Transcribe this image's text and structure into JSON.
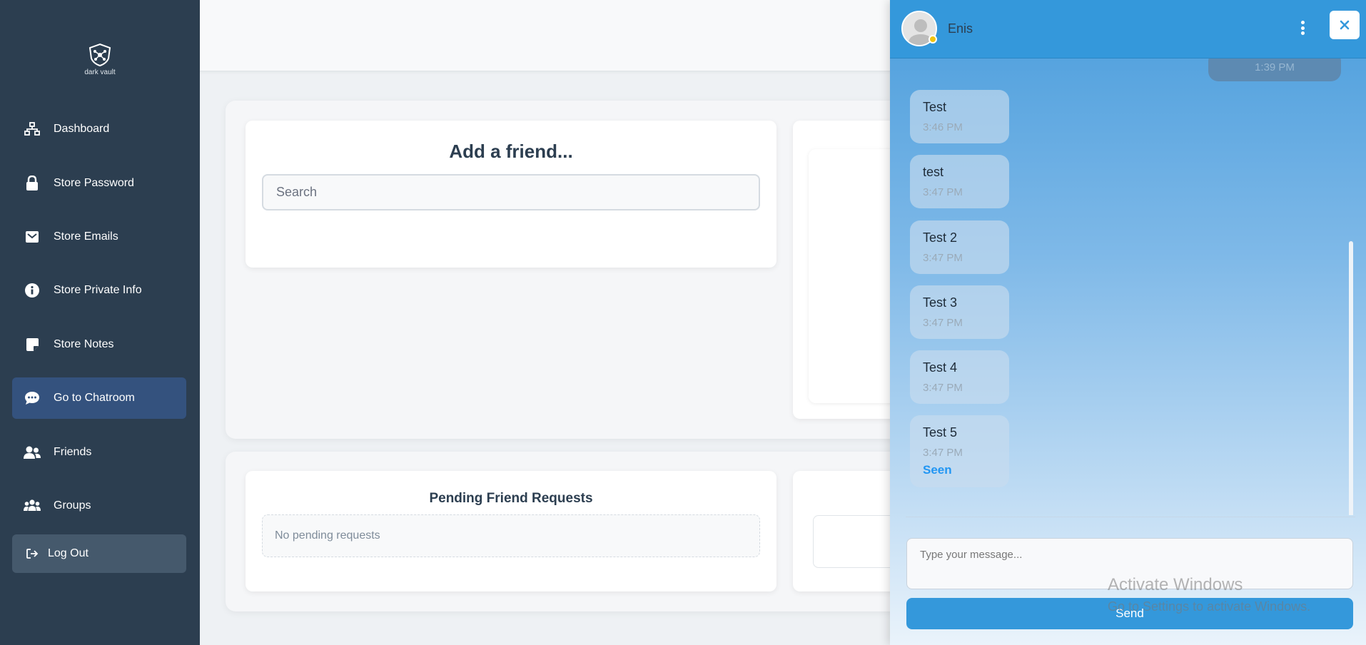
{
  "app": {
    "logo_text": "dark vault"
  },
  "sidebar": {
    "items": [
      {
        "label": "Dashboard",
        "icon": "sitemap-icon"
      },
      {
        "label": "Store Password",
        "icon": "lock-icon"
      },
      {
        "label": "Store Emails",
        "icon": "envelope-icon"
      },
      {
        "label": "Store Private Info",
        "icon": "info-circle-icon"
      },
      {
        "label": "Store Notes",
        "icon": "sticky-note-icon"
      },
      {
        "label": "Go to Chatroom",
        "icon": "chat-bubble-icon",
        "active": true
      },
      {
        "label": "Friends",
        "icon": "user-friends-icon"
      },
      {
        "label": "Groups",
        "icon": "users-icon"
      }
    ],
    "logout_label": "Log Out"
  },
  "main": {
    "add_friend": {
      "title": "Add a friend...",
      "search_placeholder": "Search"
    },
    "pending": {
      "title": "Pending Friend Requests",
      "empty_text": "No pending requests"
    }
  },
  "chat": {
    "contact_name": "Enis",
    "status_color": "#f1c40f",
    "previous_outgoing_time": "1:39 PM",
    "messages": [
      {
        "text": "Test",
        "time": "3:46 PM"
      },
      {
        "text": "test",
        "time": "3:47 PM"
      },
      {
        "text": "Test 2",
        "time": "3:47 PM"
      },
      {
        "text": "Test 3",
        "time": "3:47 PM"
      },
      {
        "text": "Test 4",
        "time": "3:47 PM"
      },
      {
        "text": "Test 5",
        "time": "3:47 PM",
        "status": "Seen"
      }
    ],
    "input_placeholder": "Type your message...",
    "send_label": "Send"
  },
  "overlay": {
    "watermark_title": "Activate Windows",
    "watermark_subtitle": "Go to Settings to activate Windows."
  },
  "colors": {
    "sidebar_bg": "#2c3e50",
    "active_item": "#34527e",
    "accent": "#3498db",
    "seen": "#2196f3"
  }
}
